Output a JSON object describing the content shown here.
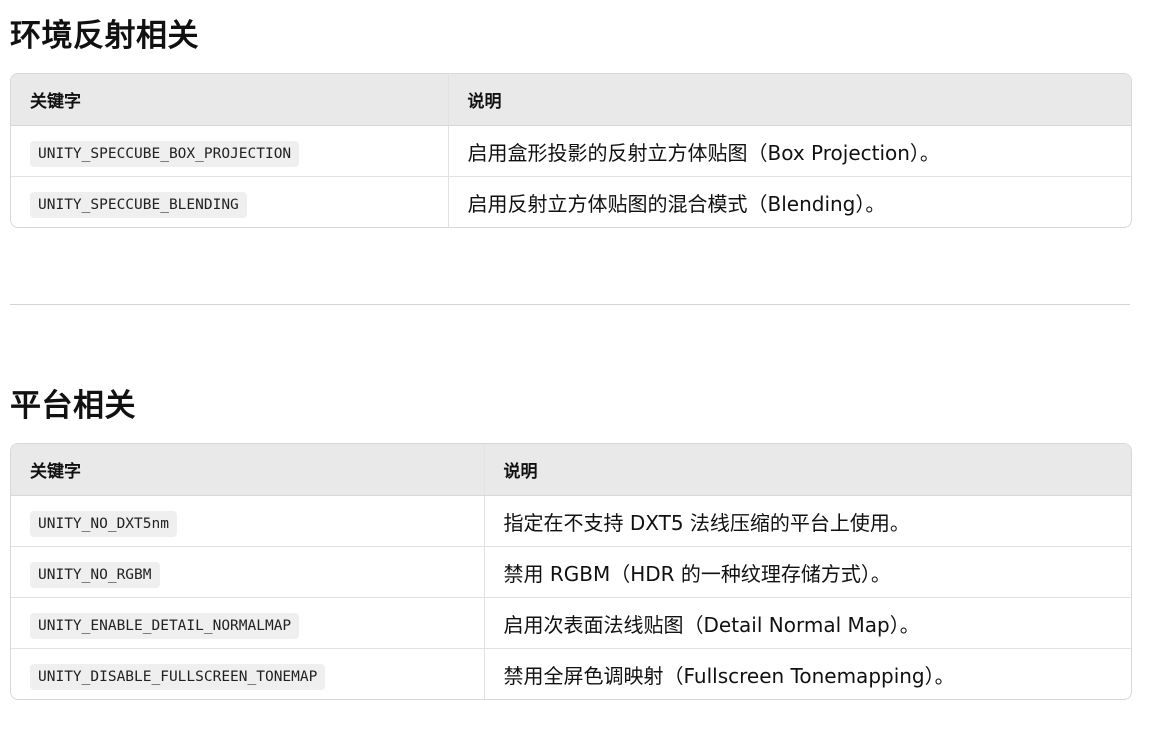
{
  "sections": [
    {
      "title": "环境反射相关",
      "headers": [
        "关键字",
        "说明"
      ],
      "rows": [
        {
          "keyword": "UNITY_SPECCUBE_BOX_PROJECTION",
          "description": "启用盒形投影的反射立方体贴图（Box Projection）。"
        },
        {
          "keyword": "UNITY_SPECCUBE_BLENDING",
          "description": "启用反射立方体贴图的混合模式（Blending）。"
        }
      ]
    },
    {
      "title": "平台相关",
      "headers": [
        "关键字",
        "说明"
      ],
      "rows": [
        {
          "keyword": "UNITY_NO_DXT5nm",
          "description": "指定在不支持 DXT5 法线压缩的平台上使用。"
        },
        {
          "keyword": "UNITY_NO_RGBM",
          "description": "禁用 RGBM（HDR 的一种纹理存储方式）。"
        },
        {
          "keyword": "UNITY_ENABLE_DETAIL_NORMALMAP",
          "description": "启用次表面法线贴图（Detail Normal Map）。"
        },
        {
          "keyword": "UNITY_DISABLE_FULLSCREEN_TONEMAP",
          "description": "禁用全屏色调映射（Fullscreen Tonemapping）。"
        }
      ]
    }
  ]
}
